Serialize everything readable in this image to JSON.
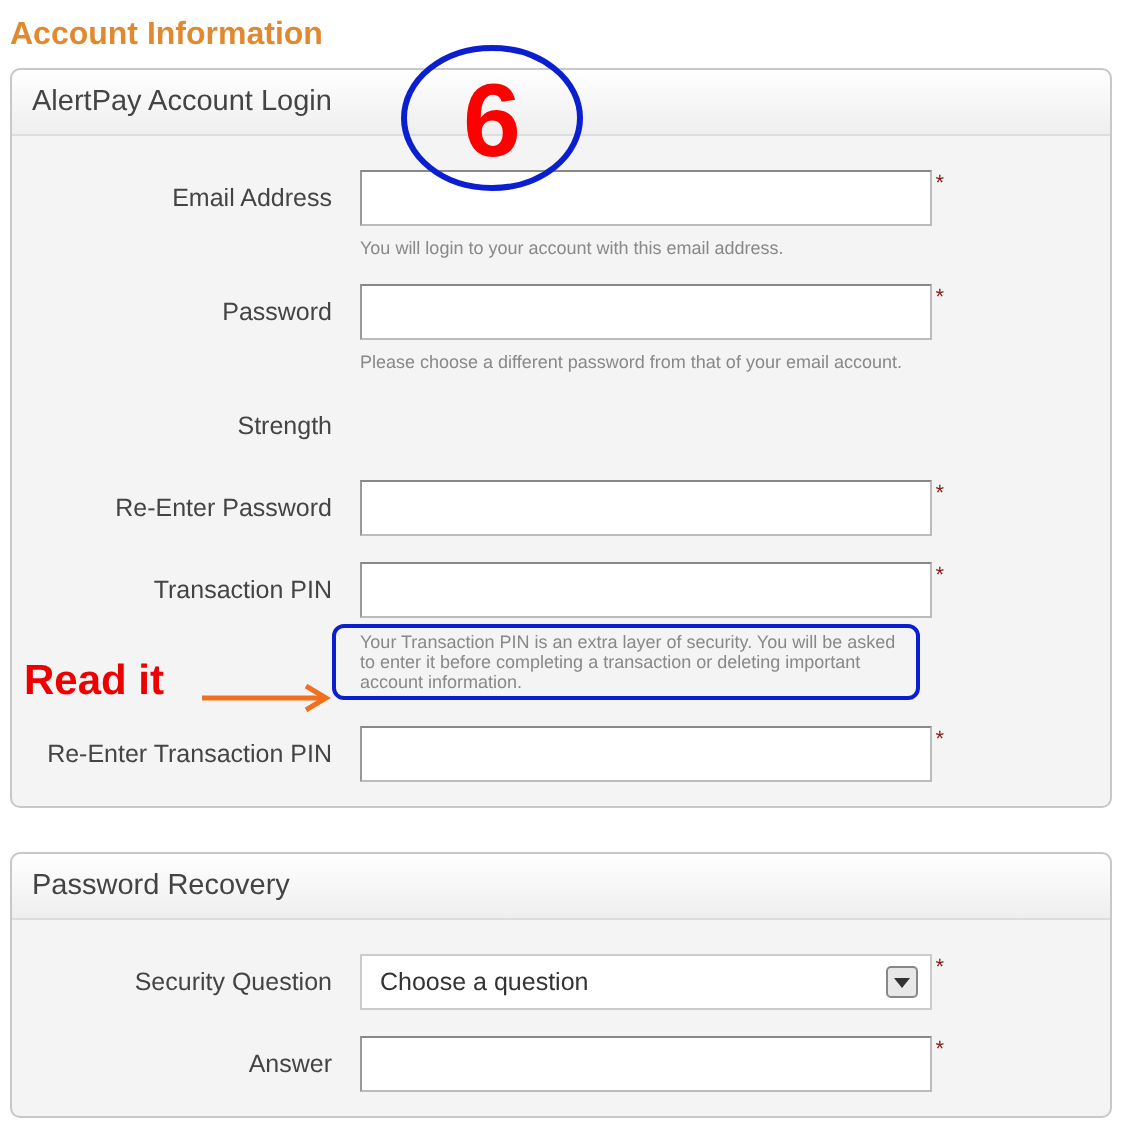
{
  "heading": "Account Information",
  "sections": [
    {
      "title": "AlertPay Account Login",
      "fields": [
        {
          "kind": "input",
          "label": "Email Address",
          "required_mark": "*",
          "help": "You will login to your account with this email address.",
          "help_highlighted": false
        },
        {
          "kind": "input",
          "label": "Password",
          "required_mark": "*",
          "help": "Please choose a different password from that of your email account.",
          "help_highlighted": false
        },
        {
          "kind": "text",
          "label": "Strength"
        },
        {
          "kind": "input",
          "label": "Re-Enter Password",
          "required_mark": "*"
        },
        {
          "kind": "input",
          "label": "Transaction PIN",
          "required_mark": "*",
          "help": "Your Transaction PIN is an extra layer of security. You will be asked to enter it before completing a transaction or deleting important account information.",
          "help_highlighted": true
        },
        {
          "kind": "input",
          "label": "Re-Enter Transaction PIN",
          "required_mark": "*"
        }
      ]
    },
    {
      "title": "Password Recovery",
      "fields": [
        {
          "kind": "select",
          "label": "Security Question",
          "value": "Choose a question",
          "required_mark": "*"
        },
        {
          "kind": "input",
          "label": "Answer",
          "required_mark": "*"
        }
      ]
    }
  ],
  "annotations": {
    "step_number": "6",
    "callout": "Read it"
  }
}
